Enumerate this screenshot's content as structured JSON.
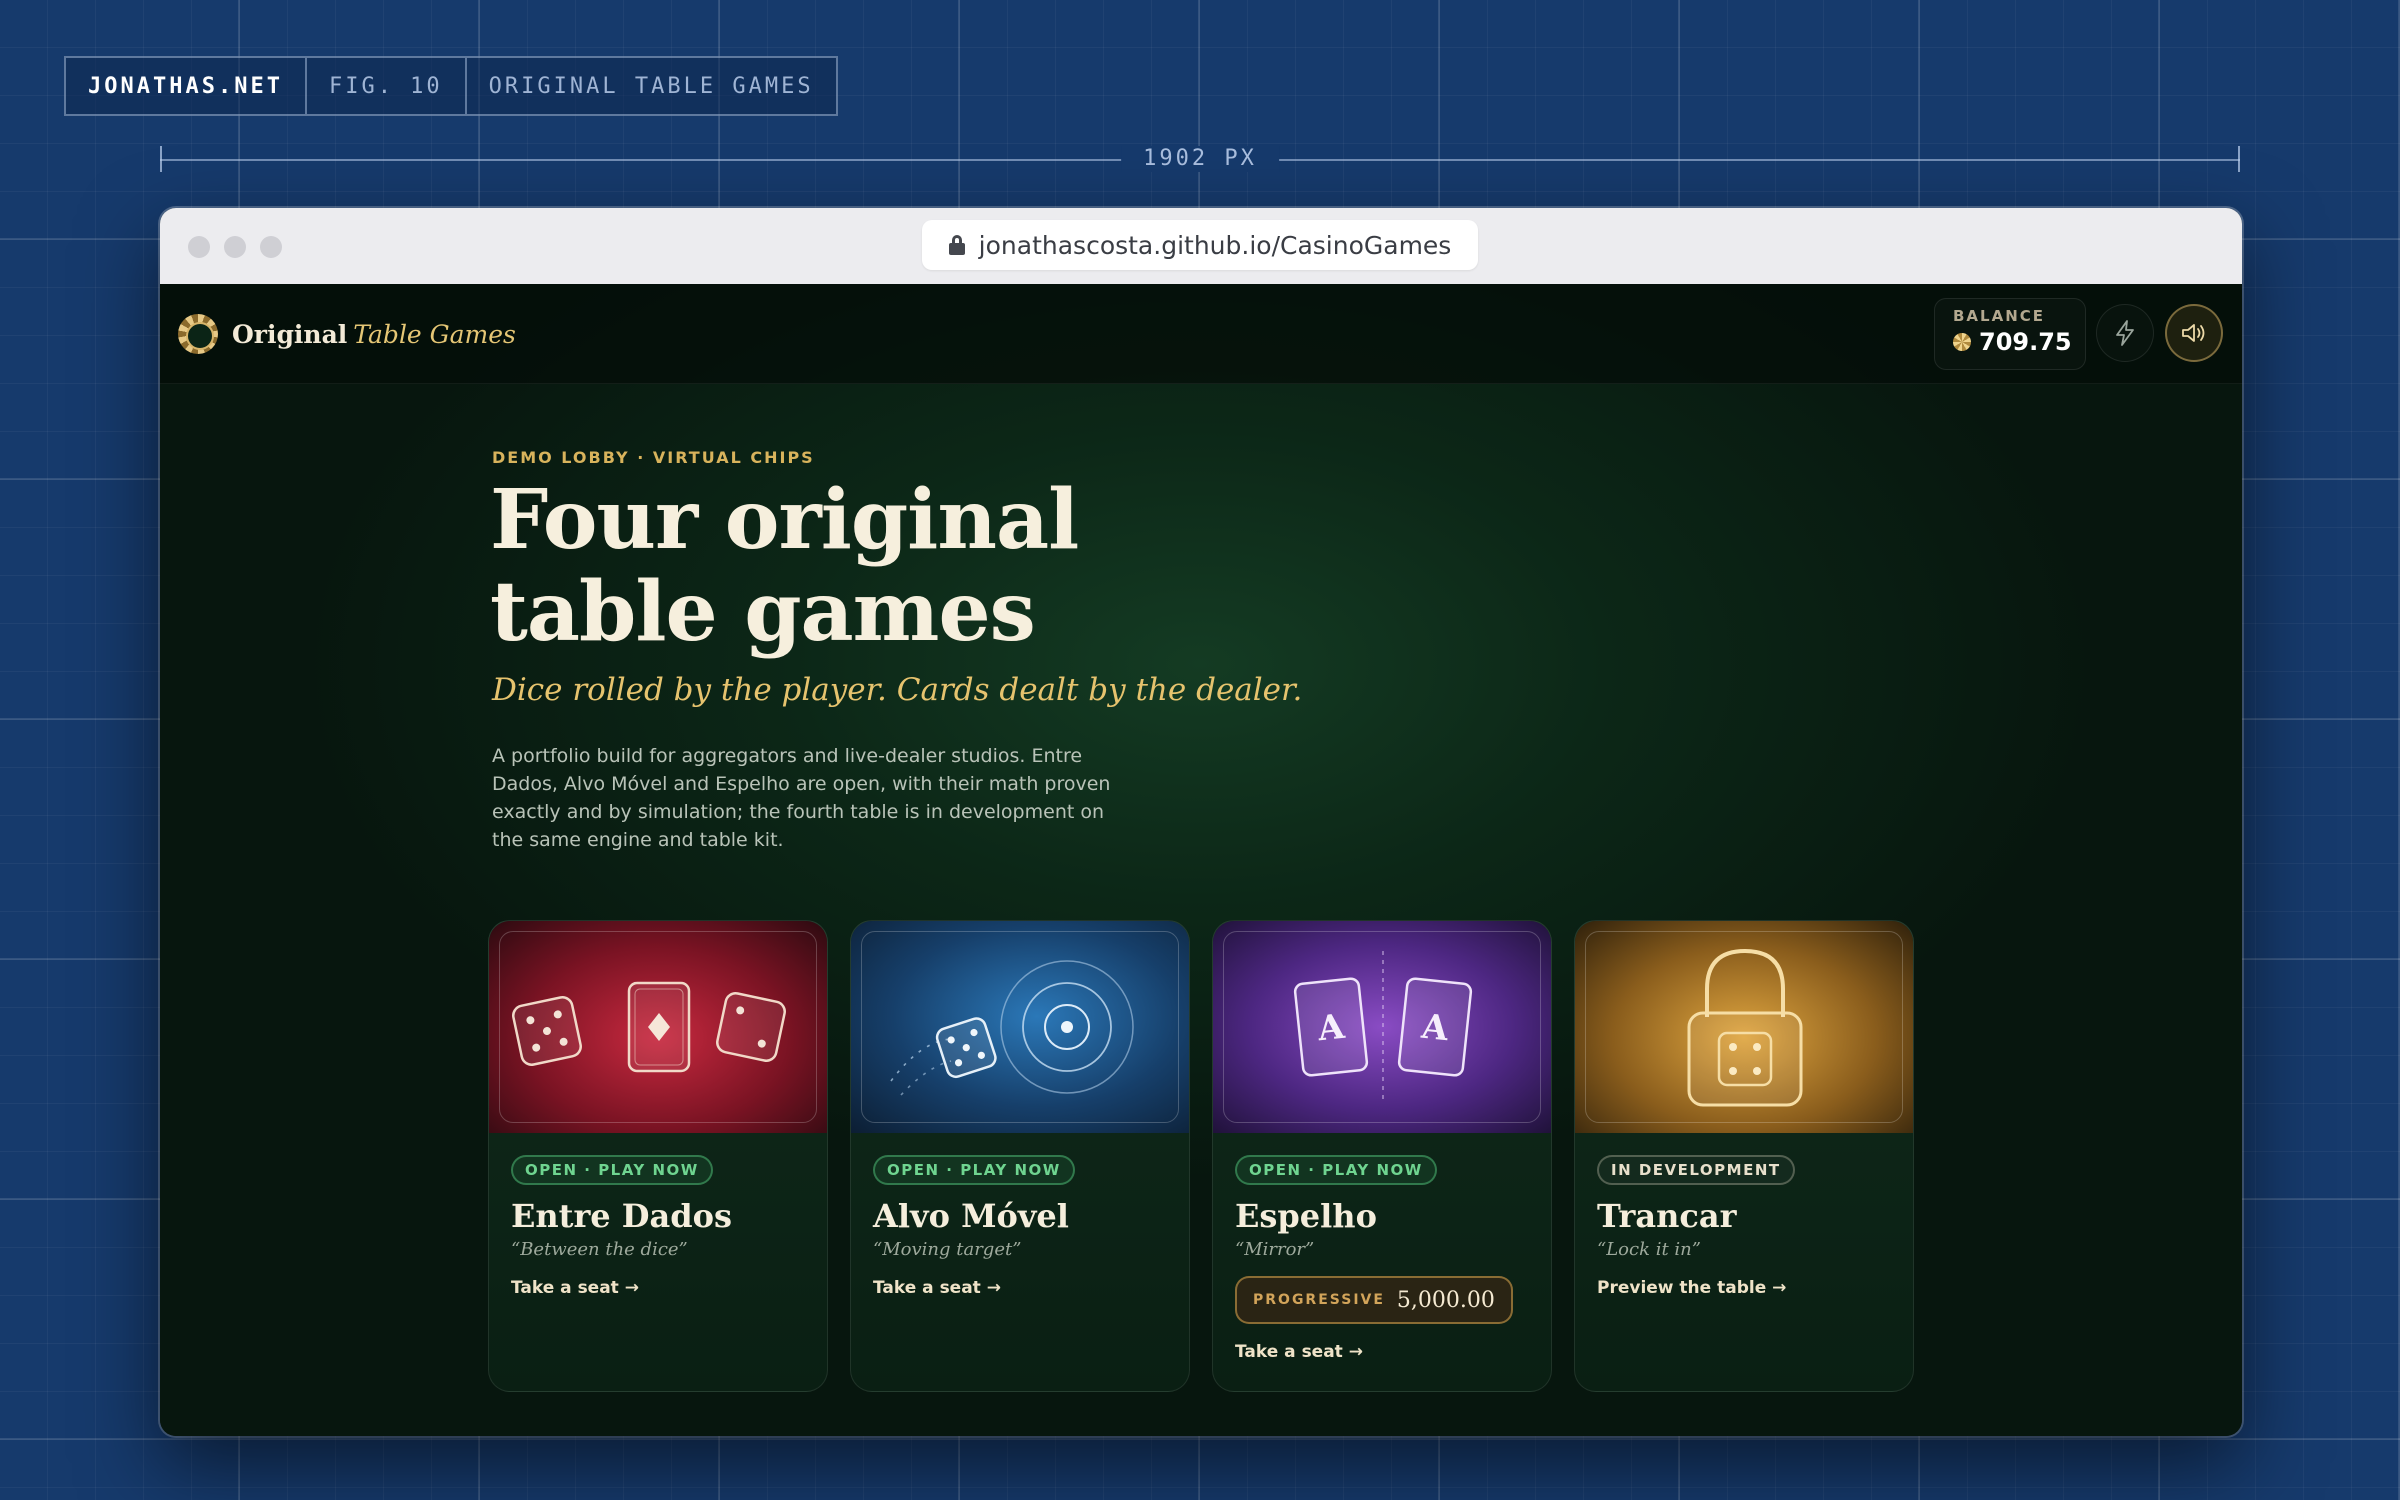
{
  "figure": {
    "site": "JONATHAS.NET",
    "fig": "FIG. 10",
    "caption": "ORIGINAL TABLE GAMES",
    "dimension_label": "1902 PX"
  },
  "browser": {
    "url": "jonathascosta.github.io/CasinoGames"
  },
  "app": {
    "brand_main": "Original",
    "brand_accent": "Table Games",
    "balance_label": "BALANCE",
    "balance_value": "709.75"
  },
  "hero": {
    "kicker": "DEMO LOBBY · VIRTUAL CHIPS",
    "title_line1": "Four original",
    "title_line2": "table games",
    "subtitle": "Dice rolled by the player. Cards dealt by the dealer.",
    "blurb": "A portfolio build for aggregators and live-dealer studios. Entre Dados, Alvo Móvel and Espelho are open, with their math proven exactly and by simulation; the fourth table is in development on the same engine and table kit."
  },
  "games": [
    {
      "badge": "OPEN · PLAY NOW",
      "name": "Entre Dados",
      "tagline": "“Between the dice”",
      "cta": "Take a seat →",
      "accent": "#c8293f"
    },
    {
      "badge": "OPEN · PLAY NOW",
      "name": "Alvo Móvel",
      "tagline": "“Moving target”",
      "cta": "Take a seat →",
      "accent": "#2b78b8"
    },
    {
      "badge": "OPEN · PLAY NOW",
      "name": "Espelho",
      "tagline": "“Mirror”",
      "progressive_label": "PROGRESSIVE",
      "progressive_value": "5,000.00",
      "cta": "Take a seat →",
      "accent": "#8a4cc4"
    },
    {
      "badge": "IN DEVELOPMENT",
      "name": "Trancar",
      "tagline": "“Lock it in”",
      "cta": "Preview the table →",
      "accent": "#e0a640"
    }
  ],
  "icons": {
    "lock": "lock-icon",
    "coin": "coin-icon",
    "bolt": "bolt-icon",
    "sound": "speaker-icon"
  }
}
